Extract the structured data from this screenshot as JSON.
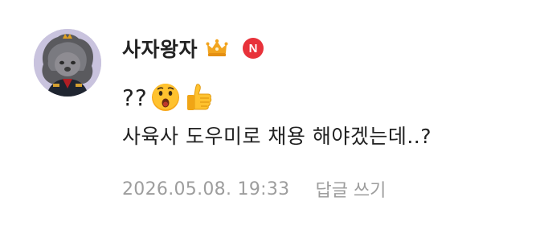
{
  "comment": {
    "author": {
      "nickname": "사자왕자",
      "avatar_icon": "lion-avatar-icon",
      "badges": [
        {
          "icon": "crown-icon",
          "color": "#f0a020"
        },
        {
          "icon": "new-badge",
          "label": "N",
          "color": "#e8323a"
        }
      ]
    },
    "text": {
      "line1": "??",
      "line1_emojis": [
        "surprised-face-emoji",
        "thumbs-up-emoji"
      ],
      "line2": "사육사 도우미로 채용 해야겠는데..?"
    },
    "timestamp": "2026.05.08. 19:33",
    "reply_label": "답글 쓰기"
  }
}
